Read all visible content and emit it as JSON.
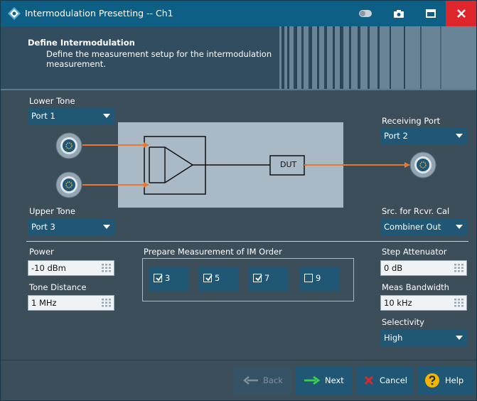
{
  "window": {
    "title": "Intermodulation Presetting -- Ch1"
  },
  "help": {
    "heading": "Define Intermodulation",
    "text": "Define the measurement setup for the intermodulation measurement."
  },
  "lower_tone": {
    "label": "Lower Tone",
    "value": "Port 1"
  },
  "upper_tone": {
    "label": "Upper Tone",
    "value": "Port 3"
  },
  "receiving_port": {
    "label": "Receiving Port",
    "value": "Port 2"
  },
  "src_rcvr_cal": {
    "label": "Src. for Rcvr. Cal",
    "value": "Combiner Out"
  },
  "diagram": {
    "dut_label": "DUT"
  },
  "power": {
    "label": "Power",
    "value": "-10 dBm"
  },
  "tone_distance": {
    "label": "Tone Distance",
    "value": "1 MHz"
  },
  "im_order": {
    "label": "Prepare Measurement of IM Order",
    "options": [
      {
        "label": "3",
        "checked": true
      },
      {
        "label": "5",
        "checked": true
      },
      {
        "label": "7",
        "checked": true
      },
      {
        "label": "9",
        "checked": false
      }
    ]
  },
  "step_attenuator": {
    "label": "Step Attenuator",
    "value": "0 dB"
  },
  "meas_bandwidth": {
    "label": "Meas Bandwidth",
    "value": "10 kHz"
  },
  "selectivity": {
    "label": "Selectivity",
    "value": "High"
  },
  "buttons": {
    "back": "Back",
    "next": "Next",
    "cancel": "Cancel",
    "help": "Help"
  },
  "colors": {
    "title_bar": "#0e5f86",
    "body": "#3d4e5b",
    "control": "#1f5775",
    "arrow": "#e8782f",
    "close": "#e0262d"
  }
}
